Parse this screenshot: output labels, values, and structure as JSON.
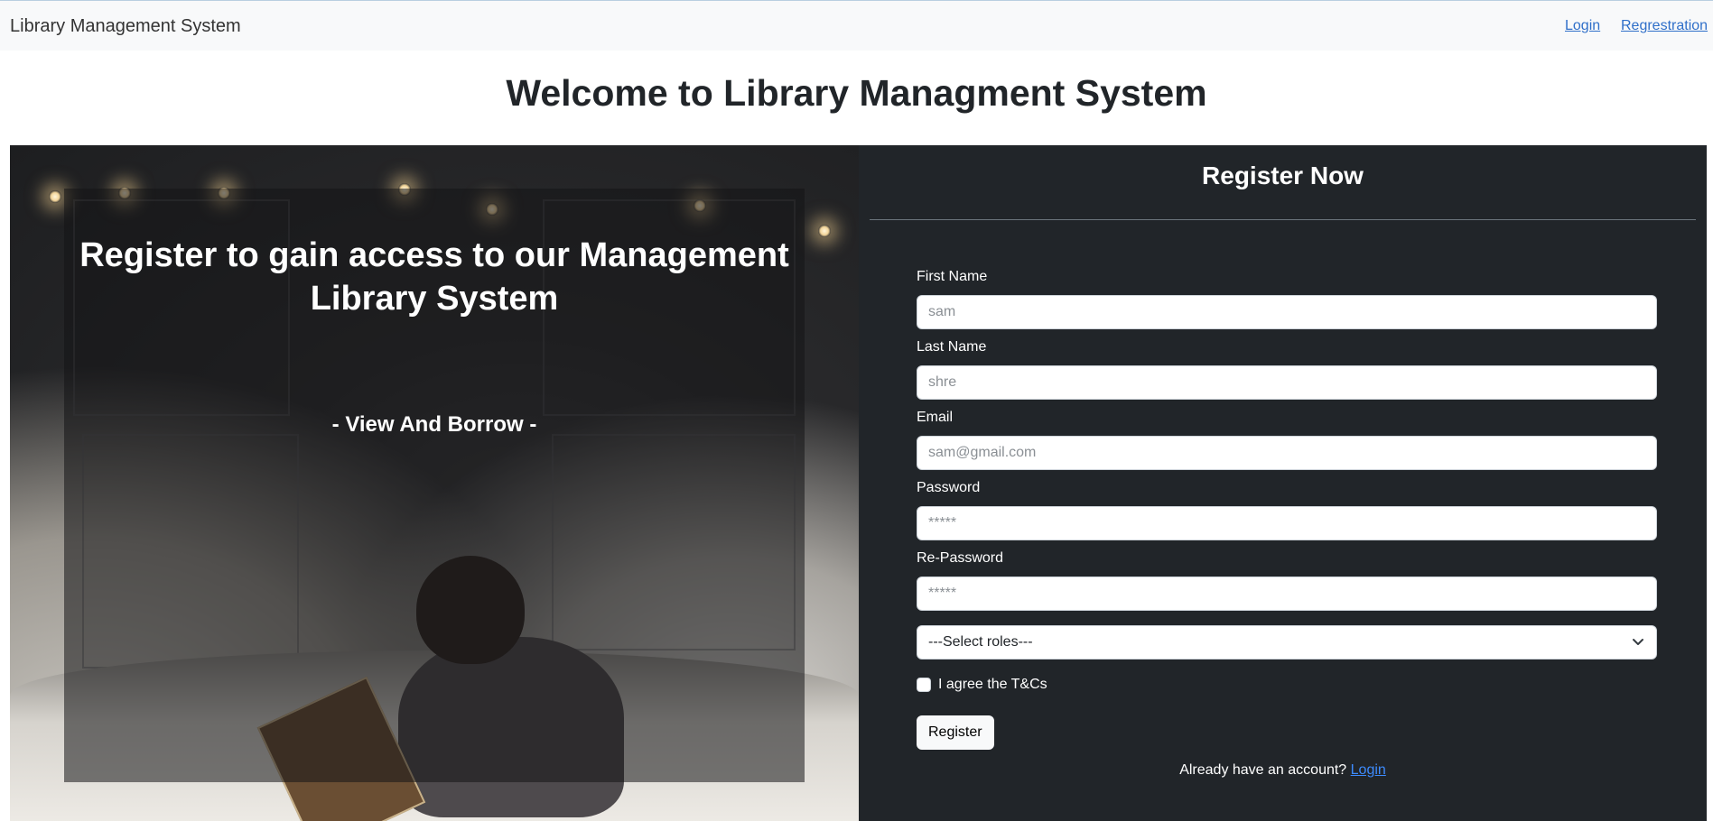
{
  "navbar": {
    "brand": "Library Management System",
    "links": [
      {
        "label": "Login"
      },
      {
        "label": "Regrestration"
      }
    ]
  },
  "page": {
    "title": "Welcome to Library Managment System"
  },
  "hero": {
    "heading": "Register to gain access to our Management Library System",
    "subheading": "- View And Borrow -"
  },
  "form": {
    "title": "Register Now",
    "fields": [
      {
        "label": "First Name",
        "placeholder": "sam",
        "value": ""
      },
      {
        "label": "Last Name",
        "placeholder": "shre",
        "value": ""
      },
      {
        "label": "Email",
        "placeholder": "sam@gmail.com",
        "value": ""
      },
      {
        "label": "Password",
        "placeholder": "*****",
        "value": ""
      },
      {
        "label": "Re-Password",
        "placeholder": "*****",
        "value": ""
      }
    ],
    "role_select": {
      "selected": "---Select roles---"
    },
    "terms": {
      "label": "I agree the T&Cs",
      "checked": false
    },
    "submit_label": "Register",
    "footer": {
      "text": "Already have an account?",
      "link": "Login"
    }
  },
  "icons": {
    "select_chevron": "chevron-down-icon"
  },
  "colors": {
    "navbar_bg": "#f8f9fa",
    "form_bg": "#212529",
    "link": "#2f6fc9",
    "footer_link": "#3d8bfd"
  }
}
